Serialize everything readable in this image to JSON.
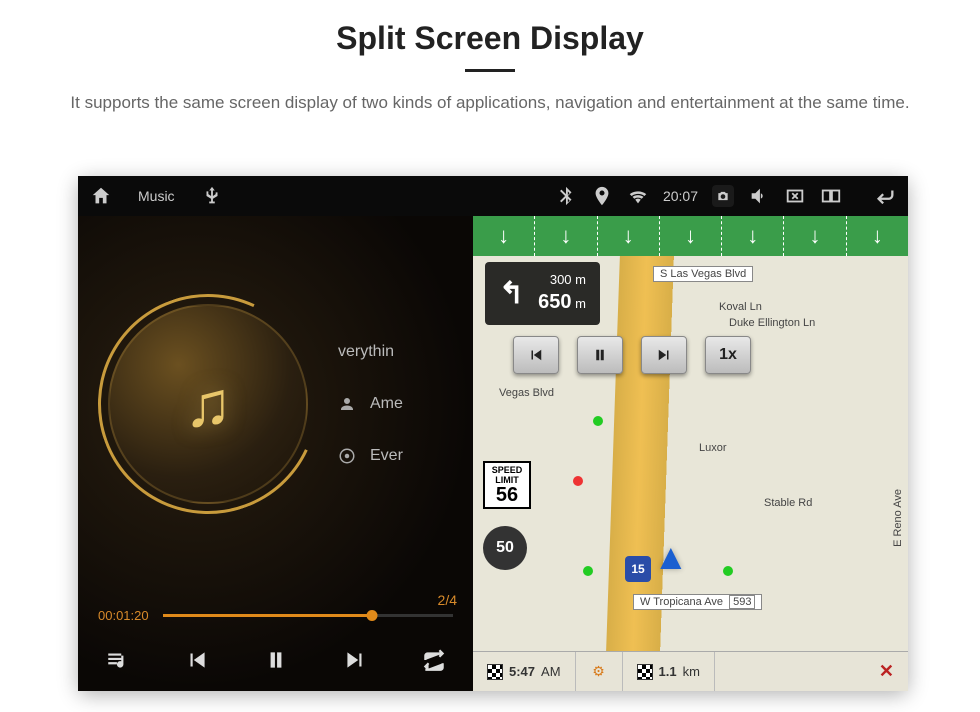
{
  "header": {
    "title": "Split Screen Display",
    "subtitle": "It supports the same screen display of two kinds of applications, navigation and entertainment at the same time."
  },
  "statusbar": {
    "tab_music": "Music",
    "time": "20:07"
  },
  "music": {
    "track_top": "verythin",
    "track_artist": "Ame",
    "track_album": "Ever",
    "counter": "2/4",
    "elapsed": "00:01:20"
  },
  "nav": {
    "turn_near": "300 m",
    "turn_main_value": "650",
    "turn_main_unit": "m",
    "playback_speed": "1x",
    "speed_limit_label": "SPEED LIMIT",
    "speed_limit_value": "56",
    "compass": "50",
    "highway_shield": "15",
    "streets": {
      "s_las_vegas": "S Las Vegas Blvd",
      "koval": "Koval Ln",
      "duke": "Duke Ellington Ln",
      "vegas_blvd": "Vegas Blvd",
      "luxor": "Luxor",
      "stable": "Stable Rd",
      "reno": "E Reno Ave",
      "tropicana": "W Tropicana Ave",
      "tropicana_num": "593"
    },
    "bottom": {
      "eta": "5:47",
      "eta_unit": "AM",
      "dist": "1.1",
      "dist_unit": "km"
    }
  }
}
